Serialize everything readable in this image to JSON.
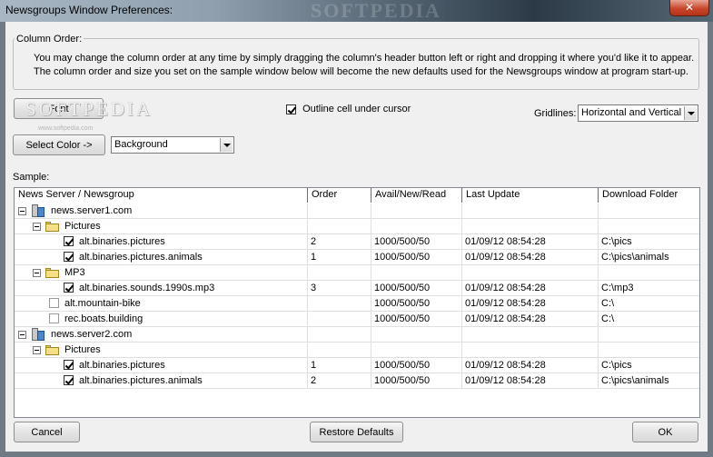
{
  "window": {
    "title": "Newsgroups Window Preferences:",
    "watermark": "SOFTPEDIA",
    "close_glyph": "✕"
  },
  "column_order": {
    "legend": "Column Order:",
    "description": "You may change the column order at any time by simply dragging the column's header button left or right and dropping it where you'd like it to appear. The column order and size you set on the sample window below will become the new defaults used for the Newsgroups window at program start-up."
  },
  "controls": {
    "font_button": "Font",
    "outline_label": "Outline cell under cursor",
    "outline_checked": true,
    "gridlines_label": "Gridlines:",
    "gridlines_value": "Horizontal and Vertical",
    "select_color_button": "Select Color ->",
    "color_target_value": "Background",
    "sample_label": "Sample:"
  },
  "softpedia_watermark": {
    "text": "SOFTPEDIA",
    "url": "www.softpedia.com"
  },
  "grid": {
    "columns": [
      "News Server / Newsgroup",
      "Order",
      "Avail/New/Read",
      "Last Update",
      "Download Folder"
    ],
    "rows": [
      {
        "kind": "server",
        "name": "news.server1.com",
        "order": "",
        "avail": "",
        "updated": "",
        "folder": ""
      },
      {
        "kind": "folder",
        "name": "Pictures",
        "order": "",
        "avail": "",
        "updated": "",
        "folder": ""
      },
      {
        "kind": "group",
        "indent": 2,
        "checked": true,
        "name": "alt.binaries.pictures",
        "order": "2",
        "avail": "1000/500/50",
        "updated": "01/09/12 08:54:28",
        "folder": "C:\\pics"
      },
      {
        "kind": "group",
        "indent": 2,
        "checked": true,
        "name": "alt.binaries.pictures.animals",
        "order": "1",
        "avail": "1000/500/50",
        "updated": "01/09/12 08:54:28",
        "folder": "C:\\pics\\animals"
      },
      {
        "kind": "folder",
        "name": "MP3",
        "order": "",
        "avail": "",
        "updated": "",
        "folder": ""
      },
      {
        "kind": "group",
        "indent": 2,
        "checked": true,
        "name": "alt.binaries.sounds.1990s.mp3",
        "order": "3",
        "avail": "1000/500/50",
        "updated": "01/09/12 08:54:28",
        "folder": "C:\\mp3"
      },
      {
        "kind": "group",
        "indent": 1,
        "checked": false,
        "name": "alt.mountain-bike",
        "order": "",
        "avail": "1000/500/50",
        "updated": "01/09/12 08:54:28",
        "folder": "C:\\"
      },
      {
        "kind": "group",
        "indent": 1,
        "checked": false,
        "name": "rec.boats.building",
        "order": "",
        "avail": "1000/500/50",
        "updated": "01/09/12 08:54:28",
        "folder": "C:\\"
      },
      {
        "kind": "server",
        "name": "news.server2.com",
        "order": "",
        "avail": "",
        "updated": "",
        "folder": ""
      },
      {
        "kind": "folder",
        "name": "Pictures",
        "order": "",
        "avail": "",
        "updated": "",
        "folder": ""
      },
      {
        "kind": "group",
        "indent": 2,
        "checked": true,
        "name": "alt.binaries.pictures",
        "order": "1",
        "avail": "1000/500/50",
        "updated": "01/09/12 08:54:28",
        "folder": "C:\\pics"
      },
      {
        "kind": "group",
        "indent": 2,
        "checked": true,
        "name": "alt.binaries.pictures.animals",
        "order": "2",
        "avail": "1000/500/50",
        "updated": "01/09/12 08:54:28",
        "folder": "C:\\pics\\animals"
      }
    ]
  },
  "footer": {
    "cancel_button": "Cancel",
    "restore_button": "Restore Defaults",
    "ok_button": "OK"
  }
}
